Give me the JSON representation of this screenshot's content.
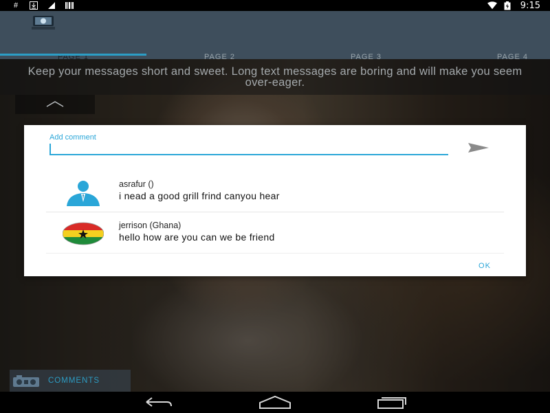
{
  "status_bar": {
    "hash_symbol": "#",
    "time": "9:15",
    "icons": [
      "hash-icon",
      "download-icon",
      "checkbox-icon",
      "barcode-icon",
      "wifi-icon",
      "battery-icon"
    ]
  },
  "header": {
    "app_icon": "app-logo-icon",
    "tabs": [
      {
        "label": "PAGE 1",
        "active": true
      },
      {
        "label": "PAGE 2",
        "active": false
      },
      {
        "label": "PAGE 3",
        "active": false
      },
      {
        "label": "PAGE 4",
        "active": false
      }
    ],
    "accent_color": "#2c9ec6"
  },
  "tip": {
    "text": "Keep your messages short and sweet. Long text messages are boring and will make you seem over-eager."
  },
  "dialog": {
    "input": {
      "placeholder": "Add comment",
      "value": ""
    },
    "send_icon": "send-icon",
    "comments": [
      {
        "author": "asrafur ()",
        "text": "i nead a good grill frind canyou hear",
        "avatar": "user-silhouette-icon"
      },
      {
        "author": "jerrison (Ghana)",
        "text": "hello how are you can we be friend",
        "avatar": "ghana-flag-icon"
      }
    ],
    "ok_label": "OK"
  },
  "comments_bar": {
    "icon": "radio-icon",
    "label": "COMMENTS"
  },
  "nav_bar": {
    "buttons": [
      "back-icon",
      "home-icon",
      "recents-icon"
    ]
  }
}
